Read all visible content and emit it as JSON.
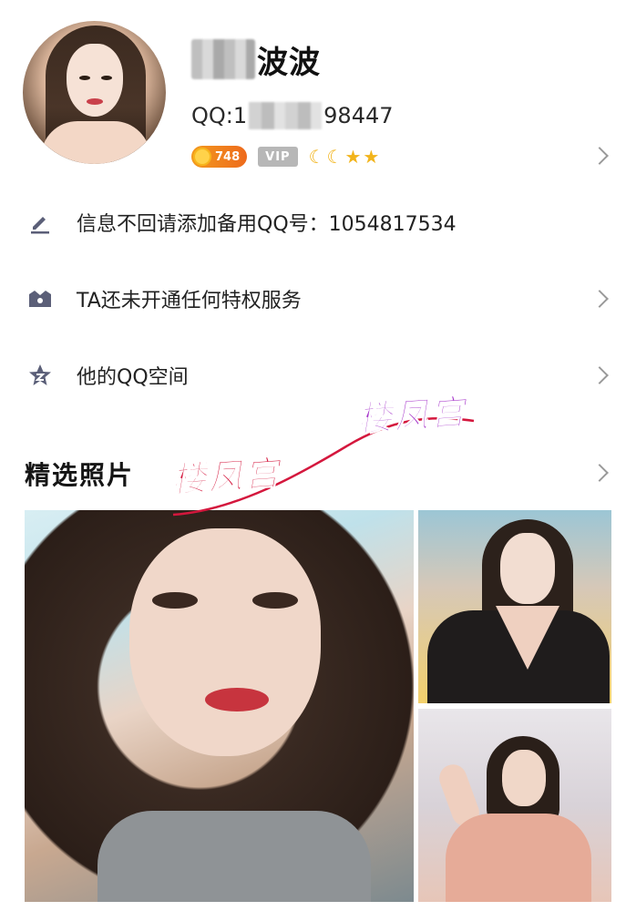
{
  "profile": {
    "nickname_visible": "波波",
    "qq_prefix": "QQ: ",
    "qq_partial_left": "1",
    "qq_partial_right": "98447",
    "coin_value": "748",
    "vip_label": "VIP",
    "level_icons": [
      "moon",
      "moon",
      "star",
      "star"
    ],
    "accent_color": "#ee6a1c"
  },
  "list": [
    {
      "icon": "pencil-icon",
      "label": "信息不回请添加备用QQ号：1054817534",
      "chevron": false
    },
    {
      "icon": "crown-icon",
      "label": "TA还未开通任何特权服务",
      "chevron": true
    },
    {
      "icon": "qzone-star-icon",
      "label": "他的QQ空间",
      "chevron": true
    }
  ],
  "photos": {
    "section_title": "精选照片"
  },
  "watermarks": {
    "text_1": "楼凤宫",
    "text_2": "楼凤宫"
  }
}
